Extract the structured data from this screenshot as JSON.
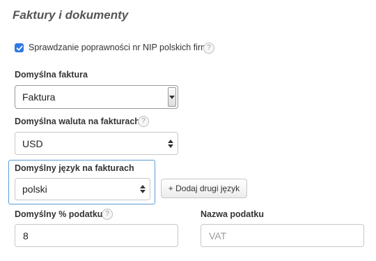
{
  "section": {
    "title": "Faktury i dokumenty"
  },
  "nip_check": {
    "label": "Sprawdzanie poprawności nr NIP polskich firm",
    "checked": true,
    "help": "?"
  },
  "default_invoice": {
    "label": "Domyślna faktura",
    "value": "Faktura"
  },
  "default_currency": {
    "label": "Domyślna waluta na fakturach",
    "value": "USD",
    "help": "?"
  },
  "default_language": {
    "label": "Domyślny język na fakturach",
    "value": "polski",
    "add_button": "+ Dodaj drugi język"
  },
  "tax_percent": {
    "label": "Domyślny % podatku",
    "value": "8",
    "help": "?"
  },
  "tax_name": {
    "label": "Nazwa podatku",
    "placeholder": "VAT"
  },
  "colors": {
    "checkbox": "#2f7ae5",
    "highlight_border": "#5b9bd5"
  }
}
